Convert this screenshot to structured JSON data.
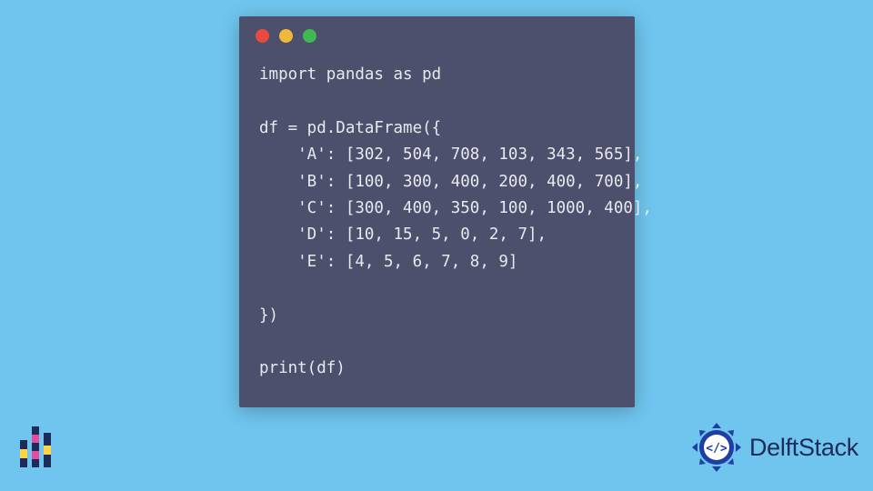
{
  "code": {
    "lines": [
      "import pandas as pd",
      "",
      "df = pd.DataFrame({",
      "    'A': [302, 504, 708, 103, 343, 565],",
      "    'B': [100, 300, 400, 200, 400, 700],",
      "    'C': [300, 400, 350, 100, 1000, 400],",
      "    'D': [10, 15, 5, 0, 2, 7],",
      "    'E': [4, 5, 6, 7, 8, 9]",
      "",
      "})",
      "",
      "print(df)"
    ]
  },
  "colors": {
    "canvas_bg": "#6fc5ee",
    "code_bg": "#4c506c",
    "code_fg": "#e8e9ef",
    "dot_red": "#e94a3f",
    "dot_yellow": "#f0b93a",
    "dot_green": "#3fb950",
    "brand_fg": "#1e2a5a",
    "brand_accent": "#1f3ea1"
  },
  "brand": {
    "name": "DelftStack"
  },
  "chart_data": {
    "type": "table",
    "title": "pandas DataFrame example",
    "columns": [
      "A",
      "B",
      "C",
      "D",
      "E"
    ],
    "data": {
      "A": [
        302,
        504,
        708,
        103,
        343,
        565
      ],
      "B": [
        100,
        300,
        400,
        200,
        400,
        700
      ],
      "C": [
        300,
        400,
        350,
        100,
        1000,
        400
      ],
      "D": [
        10,
        15,
        5,
        0,
        2,
        7
      ],
      "E": [
        4,
        5,
        6,
        7,
        8,
        9
      ]
    }
  }
}
